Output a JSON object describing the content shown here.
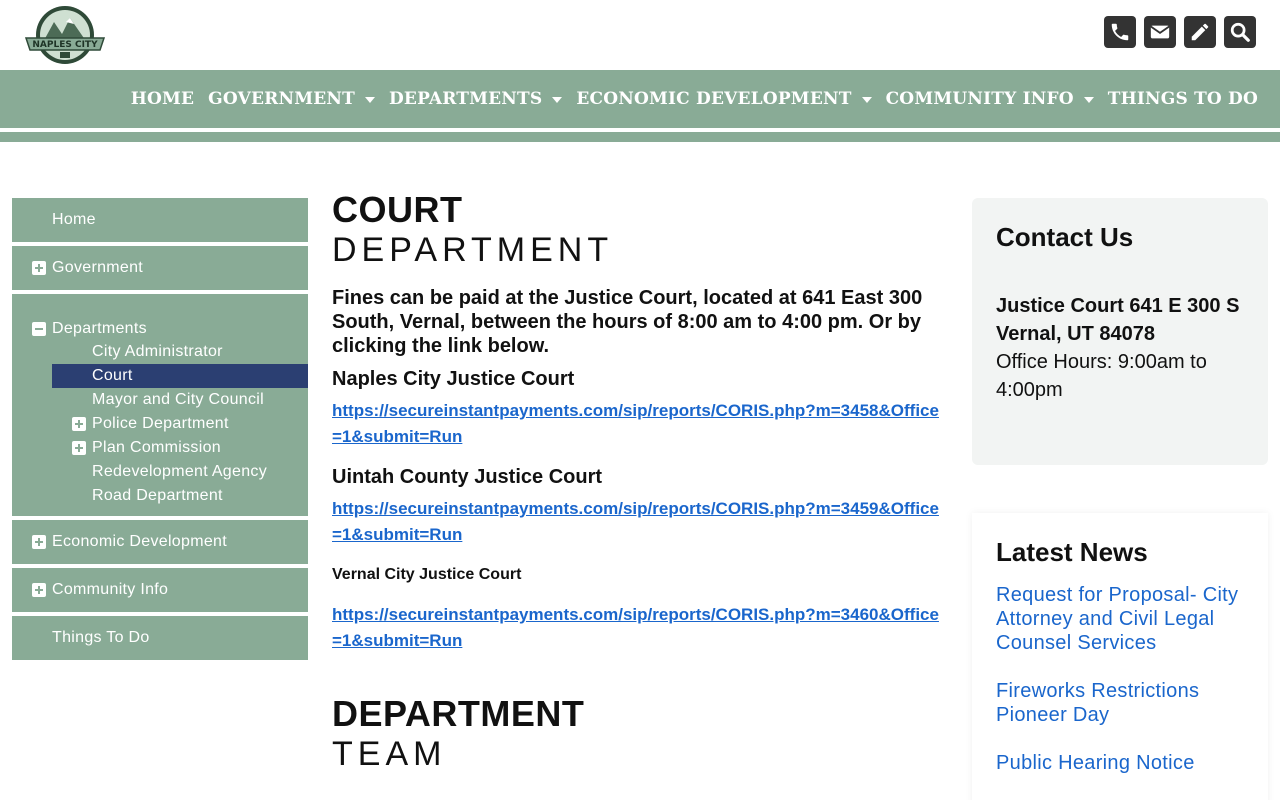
{
  "header": {
    "logo_text": "NAPLES CITY",
    "util_icons": [
      "phone-icon",
      "envelope-icon",
      "pencil-icon",
      "search-icon"
    ]
  },
  "nav": {
    "items": [
      {
        "label": "HOME",
        "dropdown": false
      },
      {
        "label": "GOVERNMENT",
        "dropdown": true
      },
      {
        "label": "DEPARTMENTS",
        "dropdown": true
      },
      {
        "label": "ECONOMIC DEVELOPMENT",
        "dropdown": true
      },
      {
        "label": "COMMUNITY INFO",
        "dropdown": true
      },
      {
        "label": "THINGS TO DO",
        "dropdown": false
      }
    ]
  },
  "sidebar": {
    "home": "Home",
    "government": "Government",
    "departments": "Departments",
    "dept_items": [
      {
        "label": "City Administrator",
        "toggle": false
      },
      {
        "label": "Court",
        "toggle": false,
        "active": true
      },
      {
        "label": "Mayor and City Council",
        "toggle": false
      },
      {
        "label": "Police Department",
        "toggle": true
      },
      {
        "label": "Plan Commission",
        "toggle": true
      },
      {
        "label": "Redevelopment Agency",
        "toggle": false
      },
      {
        "label": "Road Department",
        "toggle": false
      }
    ],
    "economic": "Economic Development",
    "community": "Community Info",
    "things": "Things To Do"
  },
  "main": {
    "title_bold": "COURT",
    "title_light": "DEPARTMENT",
    "intro": "Fines can be paid at the Justice Court, located at 641 East 300 South, Vernal, between the hours of 8:00 am to 4:00 pm. Or by clicking the link below.",
    "courts": [
      {
        "name": "Naples City Justice Court",
        "link": "https://secureinstantpayments.com/sip/reports/CORIS.php?m=3458&Office=1&submit=Run"
      },
      {
        "name": "Uintah County Justice Court",
        "link": "https://secureinstantpayments.com/sip/reports/CORIS.php?m=3459&Office=1&submit=Run"
      },
      {
        "name": "Vernal City Justice Court",
        "link": "https://secureinstantpayments.com/sip/reports/CORIS.php?m=3460&Office=1&submit=Run"
      }
    ],
    "team_bold": "DEPARTMENT",
    "team_light": "TEAM"
  },
  "contact": {
    "title": "Contact Us",
    "address": "Justice Court 641 E 300 S Vernal, UT 84078",
    "hours": "Office Hours: 9:00am to 4:00pm"
  },
  "news": {
    "title": "Latest News",
    "items": [
      "Request for Proposal- City Attorney and Civil Legal Counsel Services",
      "Fireworks Restrictions Pioneer Day",
      "Public Hearing Notice"
    ]
  },
  "colors": {
    "nav_green": "#89ab96",
    "active_navy": "#2b3f72",
    "link_blue": "#1a66cc"
  }
}
